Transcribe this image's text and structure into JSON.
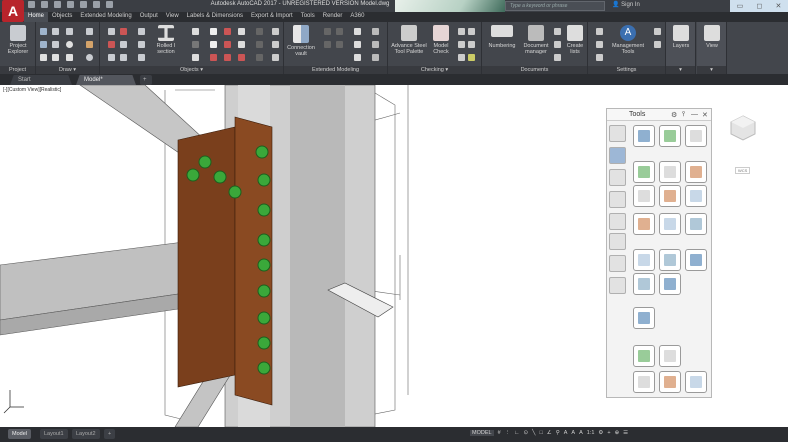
{
  "app": {
    "logo_letter": "A",
    "title": "Autodesk AutoCAD 2017 - UNREGISTERED VERSION    Model.dwg",
    "search_placeholder": "Type a keyword or phrase",
    "sign_in": "Sign In"
  },
  "ribbon_tabs": [
    "Home",
    "Objects",
    "Extended Modeling",
    "Output",
    "View",
    "Labels & Dimensions",
    "Export & Import",
    "Tools",
    "Render",
    "A360"
  ],
  "active_tab": "Home",
  "panels": {
    "project": {
      "label": "Project",
      "button": "Project Explorer"
    },
    "draw": {
      "label": "Draw ▾"
    },
    "objects": {
      "label": "Objects ▾",
      "button": "Rolled I section"
    },
    "extended_modeling": {
      "label": "Extended Modeling",
      "button": "Connection vault"
    },
    "checking": {
      "label": "Checking ▾",
      "buttons": [
        "Advance Steel Tool Palette",
        "Model Check"
      ]
    },
    "documents": {
      "label": "Documents",
      "buttons": [
        "Numbering",
        "Document manager",
        "Create lists"
      ]
    },
    "settings": {
      "label": "Settings",
      "button": "Management Tools"
    },
    "layers": {
      "label": "▾",
      "button": "Layers"
    },
    "view": {
      "label": "▾",
      "button": "View"
    }
  },
  "file_tabs": [
    "Start",
    "Model*",
    "+"
  ],
  "viewport": {
    "label": "[-][Custom View][Realistic]",
    "wcs": "WCS"
  },
  "tool_palette": {
    "title": "Tools"
  },
  "layout_tabs": [
    "Model",
    "Layout1",
    "Layout2",
    "+"
  ],
  "statusbar": {
    "mode": "MODEL",
    "scale": "1:1",
    "items": [
      "#",
      "⋮",
      "∟",
      "⊙",
      "╲",
      "□",
      "∠",
      "⚲",
      "A",
      "A",
      "A",
      "1:1",
      "⚙",
      "+",
      "⊕",
      "☰"
    ]
  },
  "colors": {
    "plate": "#7a3f1c",
    "bolt": "#3aa83a",
    "beam": "#bdbdbd",
    "column": "#c9c9c9"
  }
}
